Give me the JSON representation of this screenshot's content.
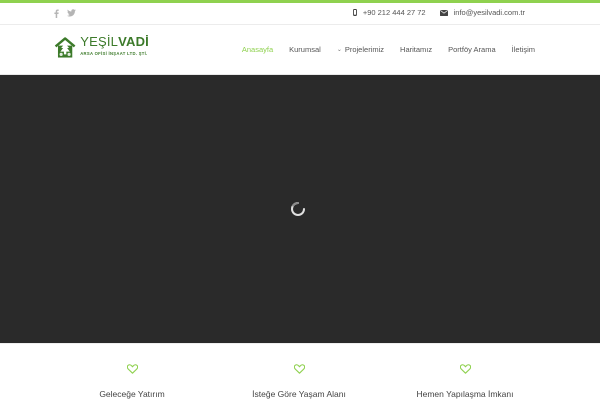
{
  "colors": {
    "accent": "#8fd14f",
    "brand_green": "#3c7a2a",
    "hero_bg": "#2a2a2a"
  },
  "topbar": {
    "social_icons": [
      "facebook-icon",
      "twitter-icon"
    ],
    "phone": "+90 212 444 27 72",
    "email": "info@yesilvadi.com.tr"
  },
  "logo": {
    "name_light": "YEŞİL",
    "name_bold": "VADİ",
    "subtitle": "ARSA OFİSİ İNŞAAT LTD. ŞTİ."
  },
  "nav": {
    "items": [
      {
        "label": "Anasayfa",
        "active": true
      },
      {
        "label": "Kurumsal",
        "active": false
      },
      {
        "label": "Projelerimiz",
        "active": false,
        "has_dropdown": true
      },
      {
        "label": "Haritamız",
        "active": false
      },
      {
        "label": "Portföy Arama",
        "active": false
      },
      {
        "label": "İletişim",
        "active": false
      }
    ]
  },
  "hero": {
    "state": "loading"
  },
  "features": [
    {
      "icon": "heart-icon",
      "label": "Geleceğe Yatırım"
    },
    {
      "icon": "heart-icon",
      "label": "İsteğe Göre Yaşam Alanı"
    },
    {
      "icon": "heart-icon",
      "label": "Hemen Yapılaşma İmkanı"
    }
  ]
}
